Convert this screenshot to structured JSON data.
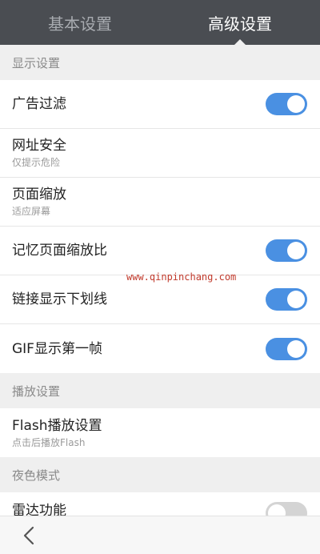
{
  "tabs": [
    {
      "label": "基本设置",
      "active": false
    },
    {
      "label": "高级设置",
      "active": true
    }
  ],
  "sections": {
    "display": {
      "header": "显示设置",
      "items": {
        "ad_filter": {
          "title": "广告过滤",
          "toggle": "on"
        },
        "url_security": {
          "title": "网址安全",
          "subtitle": "仅提示危险"
        },
        "page_zoom": {
          "title": "页面缩放",
          "subtitle": "适应屏幕"
        },
        "remember_zoom": {
          "title": "记忆页面缩放比",
          "toggle": "on"
        },
        "link_underline": {
          "title": "链接显示下划线",
          "toggle": "on"
        },
        "gif_first_frame": {
          "title": "GIF显示第一帧",
          "toggle": "on"
        }
      }
    },
    "playback": {
      "header": "播放设置",
      "items": {
        "flash": {
          "title": "Flash播放设置",
          "subtitle": "点击后播放Flash"
        }
      }
    },
    "night": {
      "header": "夜色模式",
      "items": {
        "radar": {
          "title": "雷达功能",
          "toggle": "off"
        }
      }
    }
  },
  "watermark": "www.qinpinchang.com",
  "nav": {
    "back_icon": "chevron-left-icon"
  },
  "colors": {
    "toggle_on": "#4a90e2",
    "toggle_off": "#d4d4d4",
    "tabbar": "#4a4d52"
  }
}
